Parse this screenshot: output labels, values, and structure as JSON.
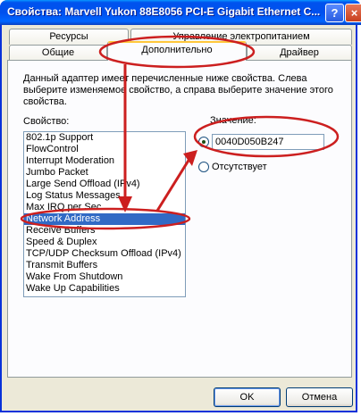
{
  "window": {
    "title": "Свойства: Marvell Yukon 88E8056 PCI-E Gigabit Ethernet C...",
    "help_label": "?",
    "close_label": "×"
  },
  "tabs": {
    "row_top": [
      {
        "label": "Ресурсы"
      },
      {
        "label": "Управление электропитанием"
      }
    ],
    "row_bottom": [
      {
        "label": "Общие"
      },
      {
        "label": "Дополнительно",
        "active": true
      },
      {
        "label": "Драйвер"
      }
    ]
  },
  "advanced": {
    "description": "Данный адаптер имеет перечисленные ниже свойства. Слева выберите изменяемое свойство, а справа выберите значение этого свойства.",
    "property_label": "Свойство:",
    "properties": [
      "802.1p Support",
      "FlowControl",
      "Interrupt Moderation",
      "Jumbo Packet",
      "Large Send Offload (IPv4)",
      "Log Status Messages",
      "Max IRQ per Sec",
      "Network Address",
      "Receive Buffers",
      "Speed & Duplex",
      "TCP/UDP Checksum Offload (IPv4)",
      "Transmit Buffers",
      "Wake From Shutdown",
      "Wake Up Capabilities"
    ],
    "selected_property": "Network Address",
    "value_label": "Значение:",
    "value": "0040D050B247",
    "absent_label": "Отсутствует"
  },
  "buttons": {
    "ok": "OK",
    "cancel": "Отмена"
  },
  "colors": {
    "annotation": "#cc1f1f",
    "selection": "#316ac5",
    "titlebar": "#0053ee"
  }
}
